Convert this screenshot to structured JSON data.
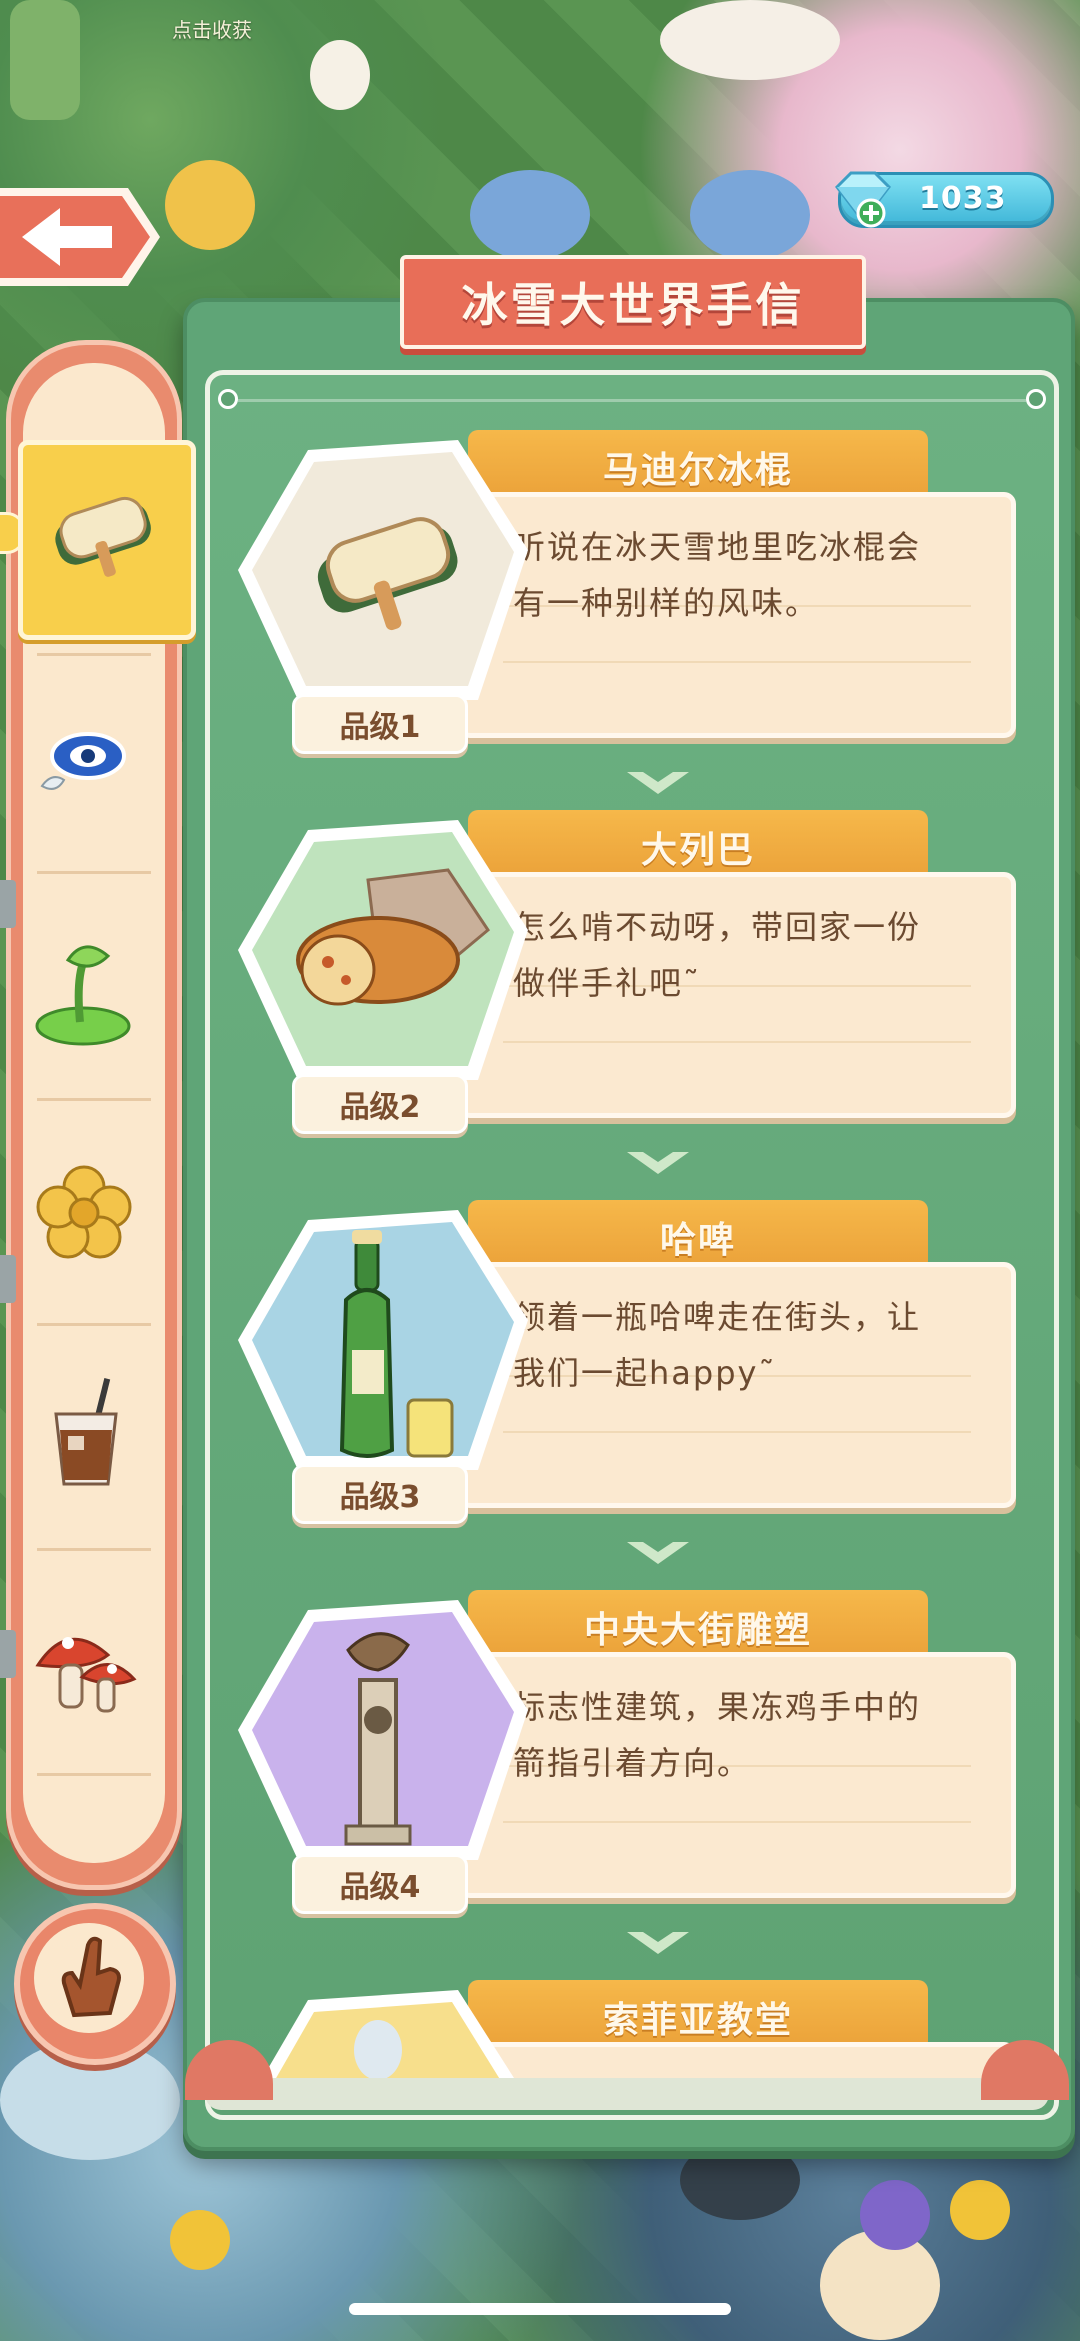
{
  "hud": {
    "harvest_hint": "点击收获",
    "gem_count": "1033",
    "gem_icon": "diamond-icon"
  },
  "panel": {
    "title": "冰雪大世界手信"
  },
  "sidebar": {
    "categories": [
      {
        "icon": "popsicle-icon",
        "selected": true
      },
      {
        "icon": "evil-eye-charm-icon",
        "selected": false
      },
      {
        "icon": "green-plant-icon",
        "selected": false
      },
      {
        "icon": "golden-flower-icon",
        "selected": false
      },
      {
        "icon": "iced-coffee-icon",
        "selected": false
      },
      {
        "icon": "mushroom-icon",
        "selected": false
      }
    ]
  },
  "cards": [
    {
      "name": "马迪尔冰棍",
      "desc": "听说在冰天雪地里吃冰棍会有一种别样的风味。",
      "grade": "品级1",
      "icon": "popsicle-icon",
      "bg": "#f1eadb"
    },
    {
      "name": "大列巴",
      "desc": "怎么啃不动呀，带回家一份做伴手礼吧˜",
      "grade": "品级2",
      "icon": "bread-icon",
      "bg": "#bfe3bd"
    },
    {
      "name": "哈啤",
      "desc": "领着一瓶哈啤走在街头，让我们一起happy˜",
      "grade": "品级3",
      "icon": "beer-bottle-icon",
      "bg": "#a9d4e4"
    },
    {
      "name": "中央大街雕塑",
      "desc": "标志性建筑，果冻鸡手中的箭指引着方向。",
      "grade": "品级4",
      "icon": "statue-icon",
      "bg": "#c9b2ec"
    },
    {
      "name": "索菲亚教堂",
      "desc": "",
      "grade": "",
      "icon": "church-icon",
      "bg": "#f7df8c"
    }
  ],
  "colors": {
    "panel_green": "#5fa577",
    "title_red": "#e86e58",
    "tab_orange": "#f6b84a",
    "card_cream": "#fbe9d0",
    "selected_yellow": "#f8cf4b"
  }
}
